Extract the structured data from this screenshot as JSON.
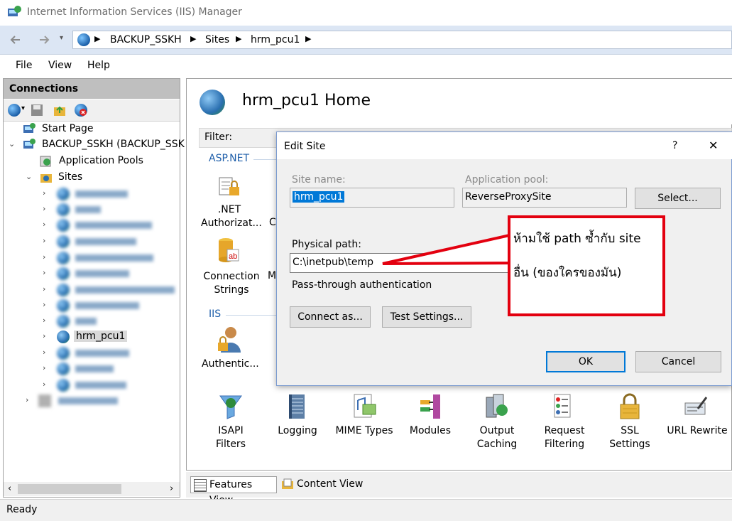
{
  "window": {
    "title": "Internet Information Services (IIS) Manager"
  },
  "address": {
    "crumbs": [
      "BACKUP_SSKH",
      "Sites",
      "hrm_pcu1"
    ]
  },
  "menu": {
    "items": [
      "File",
      "View",
      "Help"
    ]
  },
  "connections": {
    "header": "Connections",
    "tree": {
      "start_page": "Start Page",
      "server": "BACKUP_SSKH (BACKUP_SSK",
      "app_pools": "Application Pools",
      "sites": "Sites",
      "selected_site": "hrm_pcu1"
    }
  },
  "home": {
    "title": "hrm_pcu1 Home",
    "filter_label": "Filter:",
    "group_aspnet": "ASP.NET",
    "group_iis": "IIS",
    "features": {
      "net_authorization": ".NET Authorizat...",
      "connection_strings": "Connection Strings",
      "authentication": "Authentic...",
      "c_partial": "C",
      "m_partial": "M",
      "isapi_filters": "ISAPI Filters",
      "logging": "Logging",
      "mime_types": "MIME Types",
      "modules": "Modules",
      "output_caching": "Output Caching",
      "request_filtering": "Request Filtering",
      "ssl_settings": "SSL Settings",
      "url_rewrite": "URL Rewrite"
    },
    "tabs": {
      "features_view": "Features View",
      "content_view": "Content View"
    }
  },
  "status": {
    "text": "Ready"
  },
  "dialog": {
    "title": "Edit Site",
    "help": "?",
    "close": "✕",
    "site_name_label": "Site name:",
    "site_name_value": "hrm_pcu1",
    "app_pool_label": "Application pool:",
    "app_pool_value": "ReverseProxySite",
    "select_button": "Select...",
    "physical_path_label": "Physical path:",
    "physical_path_value": "C:\\inetpub\\temp",
    "passthrough_label": "Pass-through authentication",
    "connect_as_button": "Connect as...",
    "test_settings_button": "Test Settings...",
    "ok_button": "OK",
    "cancel_button": "Cancel"
  },
  "annotation": {
    "line1": "ห้ามใช้ path ซ้ำกับ site",
    "line2": "อื่น (ของใครของมัน)",
    "color": "#e3000f"
  }
}
